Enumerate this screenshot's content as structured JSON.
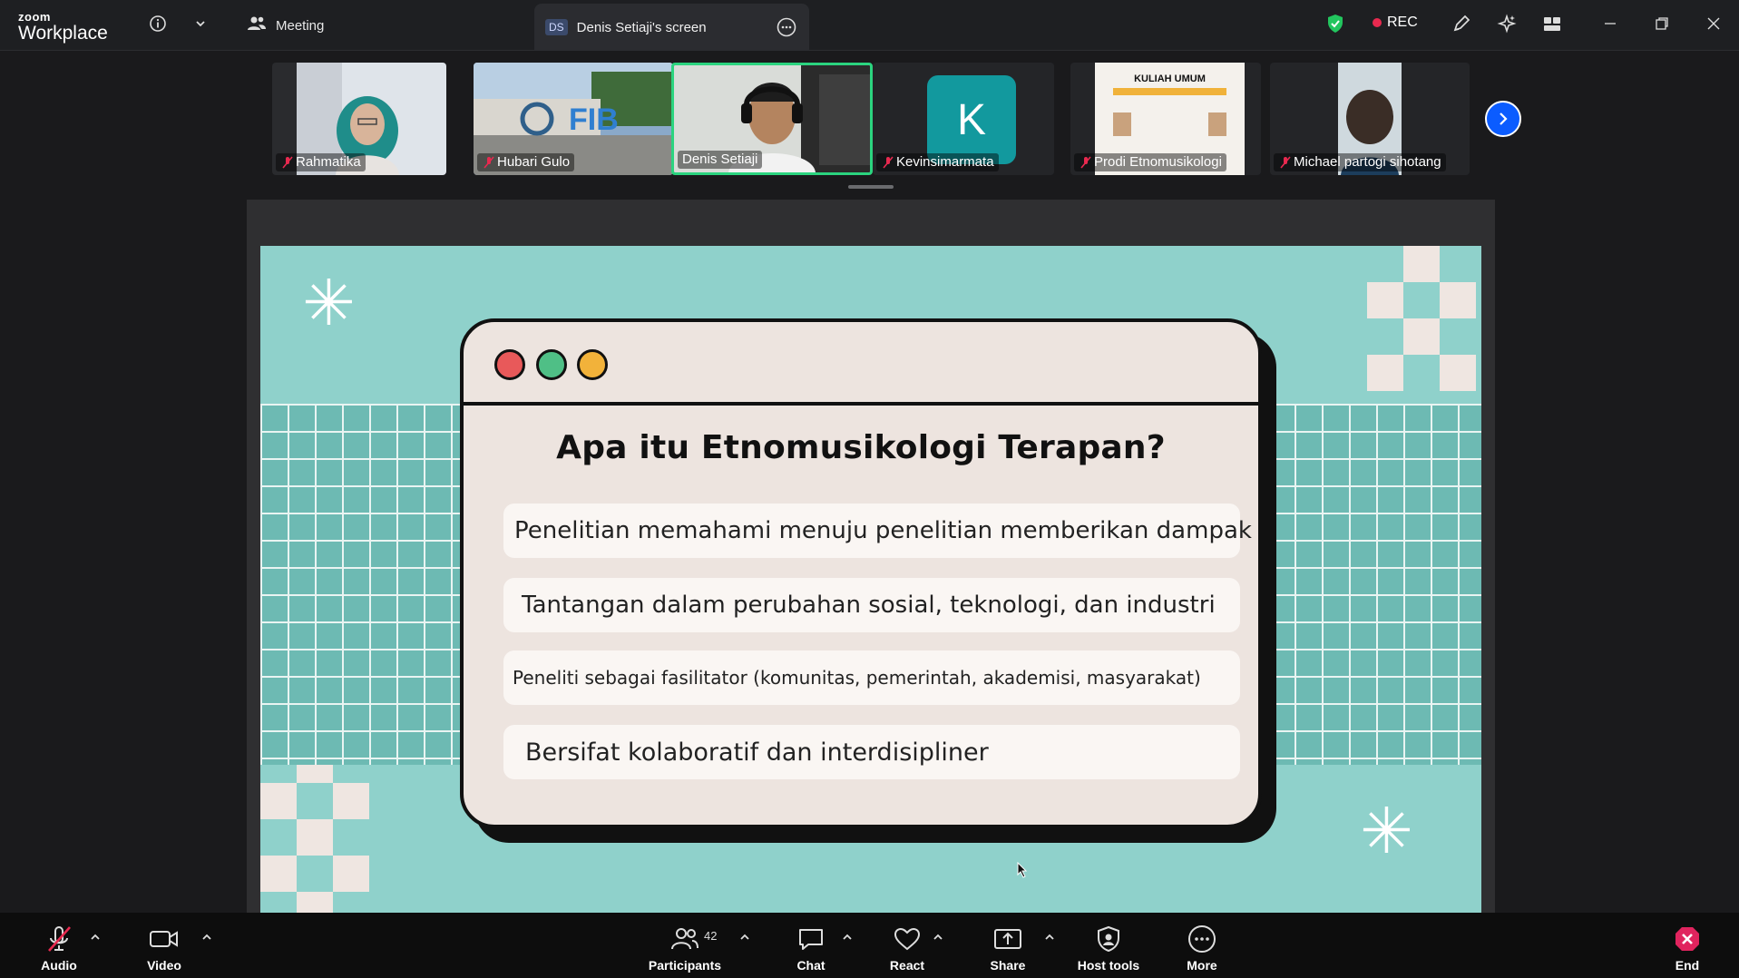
{
  "app": {
    "logo_top": "zoom",
    "logo_bottom": "Workplace"
  },
  "topbar": {
    "meeting_label": "Meeting",
    "screen_tab_initials": "DS",
    "screen_tab_label": "Denis Setiaji's screen",
    "rec_label": "REC",
    "icons": [
      "info-icon",
      "chevron-down-icon",
      "participants-icon",
      "more-icon",
      "shield-icon",
      "annotate-icon",
      "ai-companion-icon",
      "apps-icon",
      "minimize-icon",
      "restore-icon",
      "close-icon"
    ]
  },
  "participants_strip": [
    {
      "name": "Rahmatika",
      "muted": true
    },
    {
      "name": "Hubari Gulo",
      "muted": true
    },
    {
      "name": "Denis Setiaji",
      "muted": false,
      "active": true
    },
    {
      "name": "Kevinsimarmata",
      "muted": true,
      "avatar_letter": "K"
    },
    {
      "name": "Prodi Etnomusikologi",
      "muted": true,
      "thumb_text": "KULIAH UMUM"
    },
    {
      "name": "Michael partogi sihotang",
      "muted": true
    }
  ],
  "slide": {
    "title": "Apa itu Etnomusikologi  Terapan?",
    "points": [
      "Penelitian memahami menuju penelitian  memberikan dampak",
      "Tantangan  dalam perubahan sosial, teknologi, dan industri",
      "Peneliti sebagai fasilitator (komunitas, pemerintah, akademisi, masyarakat)",
      "Bersifat kolaboratif dan interdisipliner"
    ],
    "colors": {
      "background": "#8fd1cb",
      "grid": "#6dbab3",
      "card": "#ede4df",
      "light_red": "#e8595a",
      "light_green": "#4fbf86",
      "light_yellow": "#f2b23a"
    }
  },
  "toolbar": {
    "audio": "Audio",
    "video": "Video",
    "participants": "Participants",
    "participants_count": "42",
    "chat": "Chat",
    "react": "React",
    "share": "Share",
    "host_tools": "Host tools",
    "more": "More",
    "end": "End"
  }
}
